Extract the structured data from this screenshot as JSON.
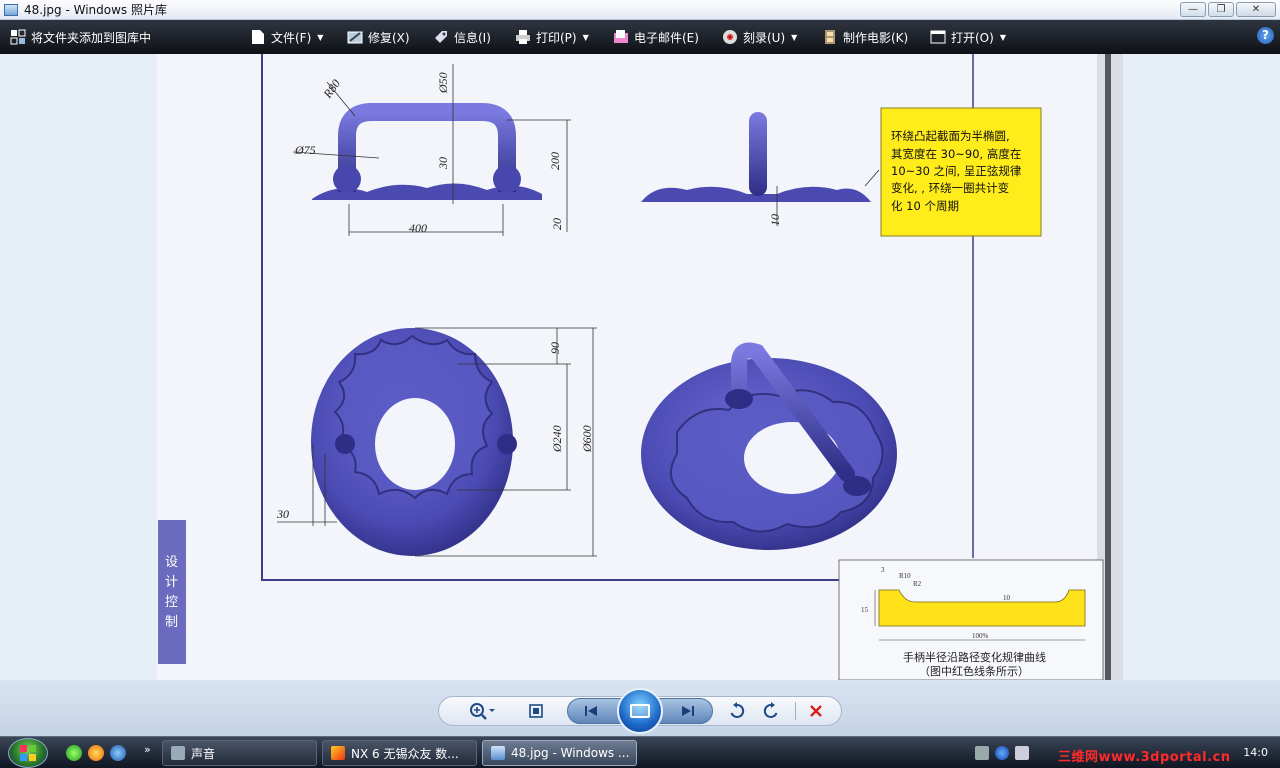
{
  "window": {
    "title": "48.jpg - Windows 照片库",
    "buttons": {
      "minimize": "—",
      "maximize": "❐",
      "close": "✕"
    }
  },
  "toolbar": {
    "add_folder": "将文件夹添加到图库中",
    "file": "文件(F)",
    "fix": "修复(X)",
    "info": "信息(I)",
    "print": "打印(P)",
    "email": "电子邮件(E)",
    "burn": "刻录(U)",
    "movie": "制作电影(K)",
    "open": "打开(O)",
    "help": "?"
  },
  "drawing": {
    "callout_lines": [
      "环绕凸起截面为半椭圆,",
      "其宽度在 30~90, 高度在",
      "10~30 之间, 呈正弦规律",
      "变化, , 环绕一圈共计变",
      "化 10 个周期"
    ],
    "side_tab": [
      "设",
      "计",
      "控",
      "制"
    ],
    "dims": {
      "r80": "R80",
      "d50": "Ø50",
      "d75": "Ø75",
      "v30": "30",
      "v200": "200",
      "v20": "20",
      "h400": "400",
      "v10": "10",
      "v90": "90",
      "d240": "Ø240",
      "d600": "Ø600",
      "h30": "30"
    },
    "inset": {
      "caption_line1": "手柄半径沿路径变化规律曲线",
      "caption_line2": "（图中红色线条所示）",
      "label_15": "15",
      "label_10": "10",
      "label_100": "100%",
      "label_3": "3",
      "label_r10": "R10",
      "label_r2": "R2"
    }
  },
  "taskbar": {
    "sound": "声音",
    "nx": "NX 6 无锡众友 数...",
    "photo": "48.jpg - Windows ...",
    "watermark": "三维网www.3dportal.cn",
    "clock": "14:0"
  },
  "colors": {
    "part_blue": "#4f4fb8",
    "part_dark": "#2c2c78",
    "callout_yellow": "#ffec1a",
    "frame_line": "#3d3d8c"
  }
}
